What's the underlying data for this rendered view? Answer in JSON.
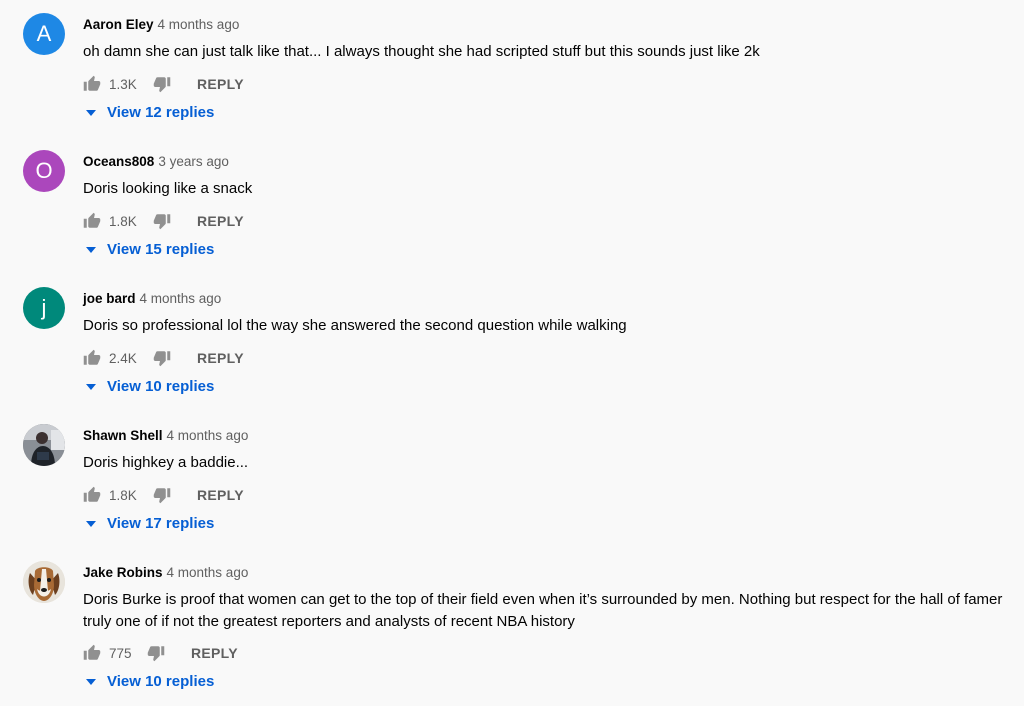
{
  "comments": [
    {
      "author": "Aaron Eley",
      "time": "4 months ago",
      "text": "oh damn she can just talk like that... I always thought she had scripted stuff but this sounds just like 2k",
      "likes": "1.3K",
      "reply_label": "REPLY",
      "view_replies": "View 12 replies",
      "avatar_letter": "A",
      "avatar_color": "#1e88e5"
    },
    {
      "author": "Oceans808",
      "time": "3 years ago",
      "text": "Doris looking like a snack",
      "likes": "1.8K",
      "reply_label": "REPLY",
      "view_replies": "View 15 replies",
      "avatar_letter": "O",
      "avatar_color": "#ab47bc"
    },
    {
      "author": "joe bard",
      "time": "4 months ago",
      "text": "Doris so professional lol the way she answered the second question while walking",
      "likes": "2.4K",
      "reply_label": "REPLY",
      "view_replies": "View 10 replies",
      "avatar_letter": "j",
      "avatar_color": "#00897b"
    },
    {
      "author": "Shawn Shell",
      "time": "4 months ago",
      "text": "Doris highkey a baddie...",
      "likes": "1.8K",
      "reply_label": "REPLY",
      "view_replies": "View 17 replies",
      "avatar_icon": "person-photo"
    },
    {
      "author": "Jake Robins",
      "time": "4 months ago",
      "text": "Doris Burke is proof that women can get to the top of their field even when it’s surrounded by men. Nothing but respect for the hall of famer truly one of if not the greatest reporters and analysts of recent NBA history",
      "likes": "775",
      "reply_label": "REPLY",
      "view_replies": "View 10 replies",
      "avatar_icon": "beagle-dog-photo"
    }
  ],
  "colors": {
    "link": "#065fd4",
    "muted": "#606060",
    "background": "#f9f9f9"
  }
}
